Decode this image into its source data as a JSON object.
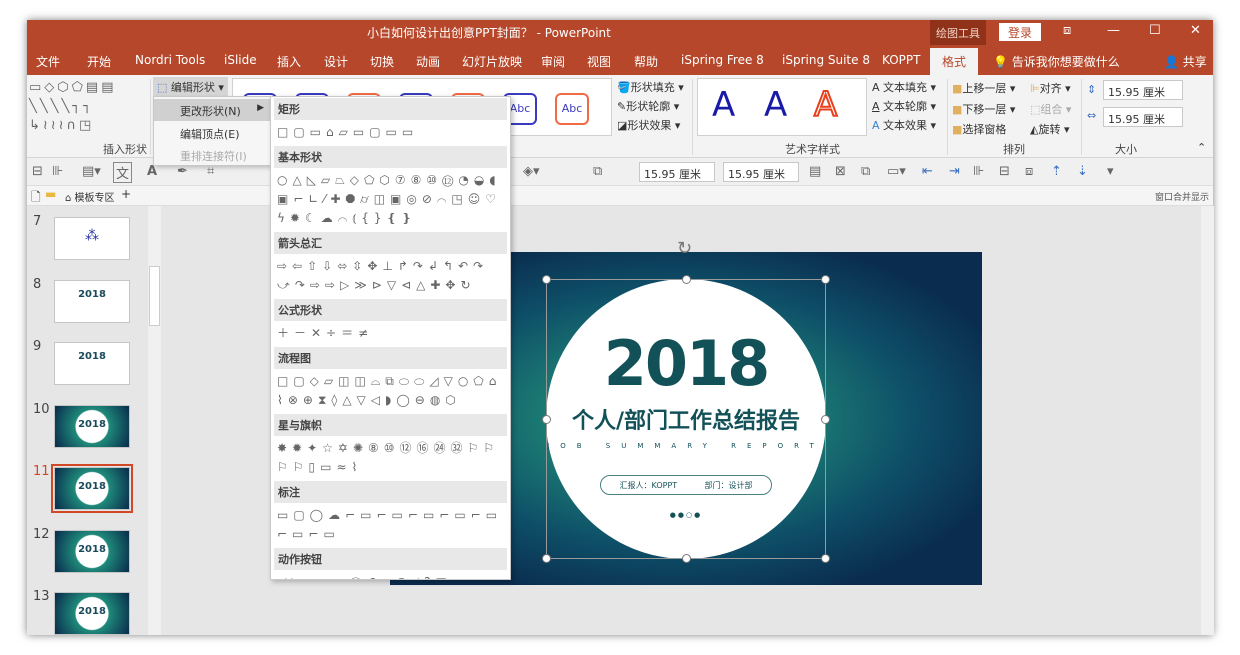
{
  "window": {
    "title": "小白如何设计出创意PPT封面？ - PowerPoint",
    "context_tool": "绘图工具",
    "login": "登录",
    "min": "—",
    "max": "☐",
    "close": "✕",
    "restore": "⧈"
  },
  "tabs": [
    "文件",
    "开始",
    "Nordri Tools",
    "iSlide",
    "插入",
    "设计",
    "切换",
    "动画",
    "幻灯片放映",
    "审阅",
    "视图",
    "帮助",
    "iSpring Free 8",
    "iSpring Suite 8",
    "KOPPT",
    "格式"
  ],
  "active_tab": "格式",
  "tell_me": "告诉我你想要做什么",
  "share": "共享",
  "ribbon": {
    "edit_shape": "编辑形状",
    "insert_shapes_label": "插入形状",
    "shape_fill": "形状填充",
    "shape_outline": "形状轮廓",
    "shape_effect": "形状效果",
    "abc": "Abc",
    "art_A": "A",
    "text_fill": "文本填充",
    "text_outline": "文本轮廓",
    "text_effect": "文本效果",
    "wordart_label": "艺术字样式",
    "bring_forward": "上移一层",
    "send_backward": "下移一层",
    "selection_pane": "选择窗格",
    "align": "对齐",
    "group": "组合",
    "rotate": "旋转",
    "arrange_label": "排列",
    "height": "15.95 厘米",
    "width": "15.95 厘米",
    "size_label": "大小"
  },
  "quickbar": {
    "h": "15.95 厘米",
    "w": "15.95 厘米",
    "text_icon": "文",
    "font_a": "A"
  },
  "tabbar": {
    "template": "模板专区",
    "add": "+",
    "merge": "窗口合并显示"
  },
  "menu": {
    "change_shape": "更改形状(N)",
    "edit_points": "编辑顶点(E)",
    "reroute": "重排连接符(I)"
  },
  "shape_gallery": [
    {
      "name": "矩形",
      "glyphs": "□▢▭⌂▱▭▢▭▭"
    },
    {
      "name": "基本形状",
      "glyphs": "○△◺▱⏢◇⬠⬡⑦⑧⑩⑫◔◒◖▣⌐∟⁄✚⯃⌭◫▣◎⊘⌒◳☺♡ϟ✹☾☁⌒⦅{}❴❵"
    },
    {
      "name": "箭头总汇",
      "glyphs": "⇨⇦⇧⇩⬄⇳✥⊥↱↷↲↰↶↷⤻↷⇨⇨▷≫⊳▽⊲△✚✥↻"
    },
    {
      "name": "公式形状",
      "glyphs": "＋－✕÷＝≠"
    },
    {
      "name": "流程图",
      "glyphs": "□▢◇▱◫◫⌓⧉⬭⬭◿▽○⬠⌂⌇⊗⊕⧗◊△▽◁◗◯⊖◍⬡"
    },
    {
      "name": "星与旗帜",
      "glyphs": "✸✹✦☆✡✺⑧⑩⑫⑯㉔㉜⚐⚐⚐⚐▯▭≈⌇"
    },
    {
      "name": "标注",
      "glyphs": "▭▢◯☁⌐▭⌐▭⌐▭⌐▭⌐▭⌐▭⌐▭"
    },
    {
      "name": "动作按钮",
      "glyphs": "◁▷⏮⏭⌂ⓘ↶▭▯◁?□"
    }
  ],
  "thumbnails": [
    {
      "n": "7"
    },
    {
      "n": "8",
      "t": "2018"
    },
    {
      "n": "9",
      "t": "2018"
    },
    {
      "n": "10",
      "t": "2018"
    },
    {
      "n": "11",
      "t": "2018"
    },
    {
      "n": "12",
      "t": "2018"
    },
    {
      "n": "13",
      "t": "2018"
    }
  ],
  "selected_slide": "11",
  "slide": {
    "year": "2018",
    "title": "个人/部门工作总结报告",
    "subtitle": "JOB SUMMARY REPORT",
    "reporter": "汇报人：KOPPT",
    "dept": "部门：设计部"
  },
  "colors": {
    "accent": "#b7472a",
    "teal": "#125157"
  }
}
